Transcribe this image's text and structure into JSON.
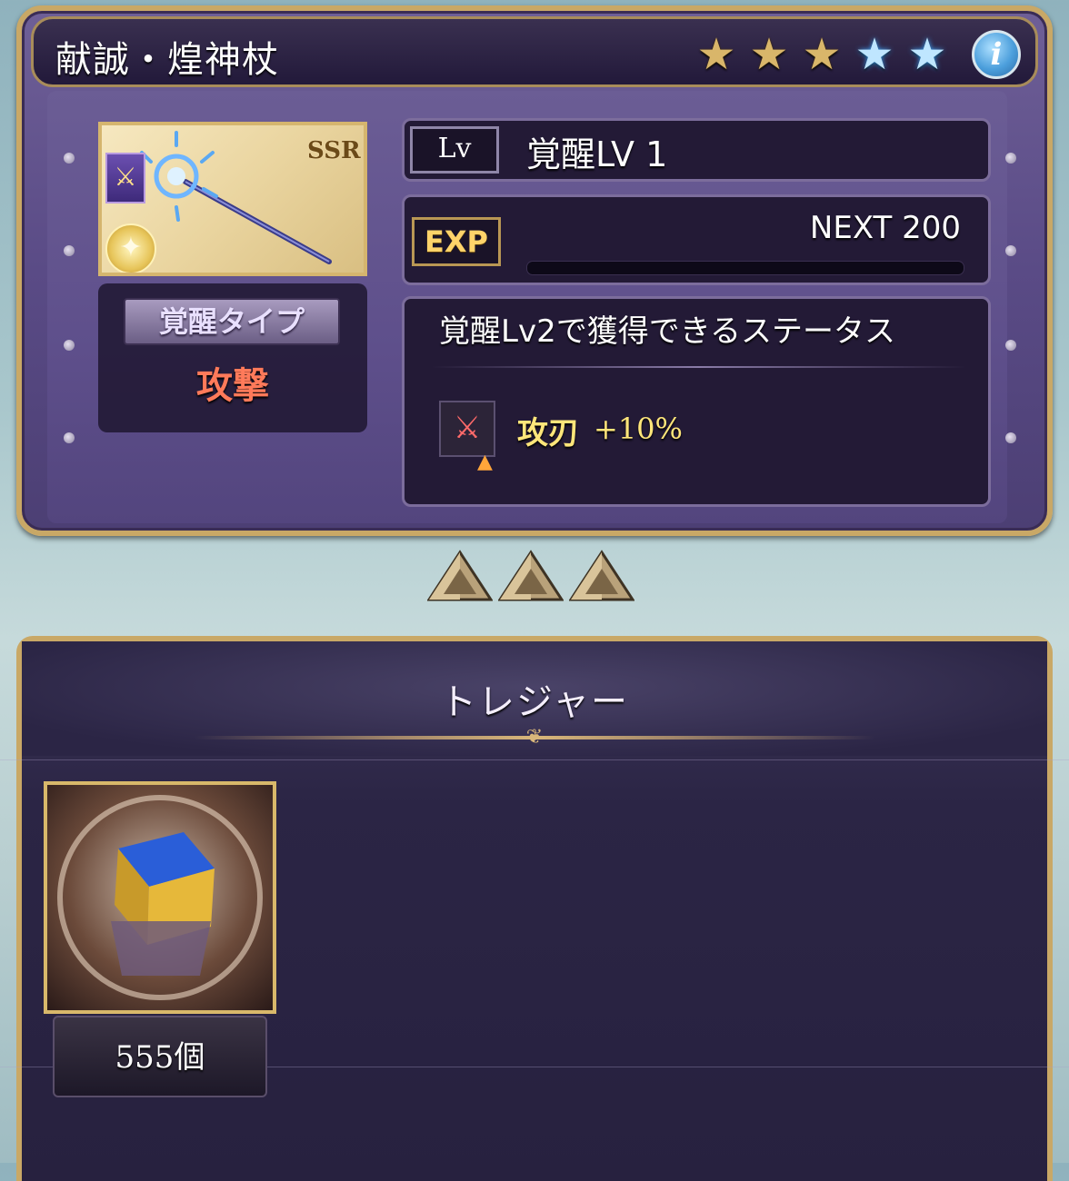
{
  "weapon": {
    "name": "献誠・煌神杖",
    "rarity_badge": "SSR",
    "stars": {
      "gold": 3,
      "blue": 2
    }
  },
  "level": {
    "tag": "Lv",
    "text": "覚醒LV 1"
  },
  "exp": {
    "tag": "EXP",
    "next": "NEXT 200",
    "progress_fraction": 0
  },
  "awaken_type": {
    "label": "覚醒タイプ",
    "value": "攻撃"
  },
  "next_status": {
    "heading": "覚醒Lv2で獲得できるステータス",
    "skill_name": "攻刃",
    "skill_value": "+10%",
    "skill_icon": "attack-up-icon"
  },
  "treasure": {
    "title": "トレジャー",
    "count": "555個"
  },
  "colors": {
    "panel": "#5a4b86",
    "gold_border": "#c9a866",
    "awaken_value": "#ff7a5a",
    "skill_text": "#ffe67a"
  }
}
